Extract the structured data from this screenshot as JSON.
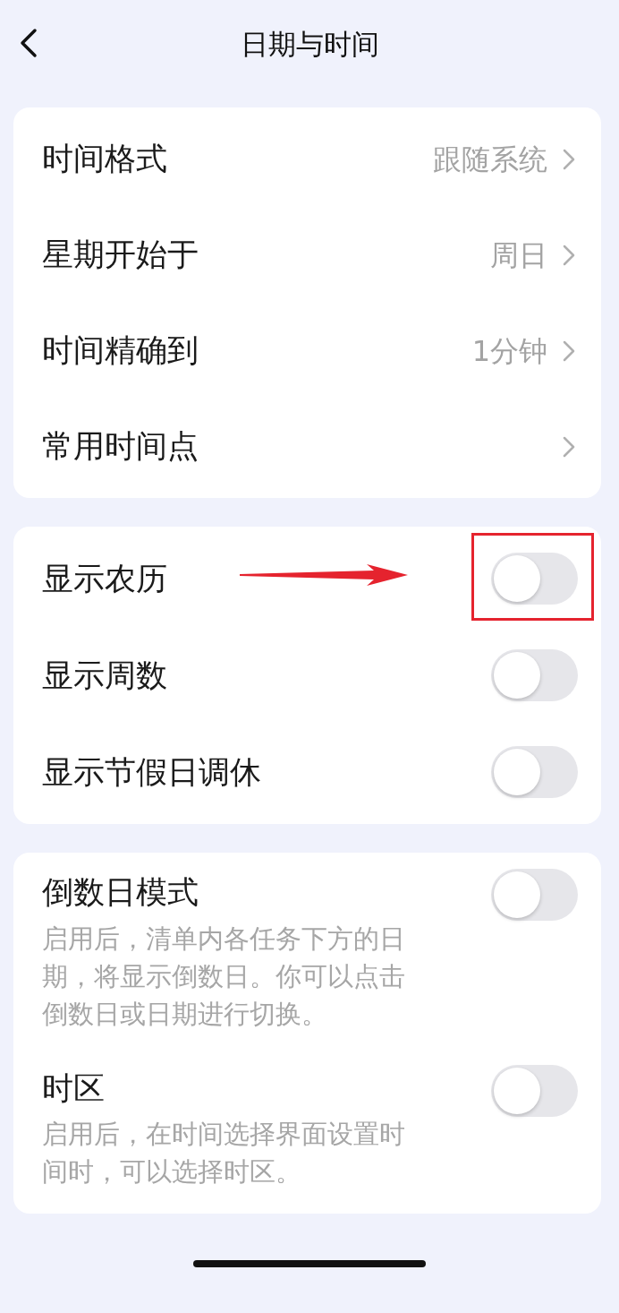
{
  "header": {
    "title": "日期与时间"
  },
  "sections": [
    {
      "items": [
        {
          "kind": "nav",
          "label": "时间格式",
          "value": "跟随系统"
        },
        {
          "kind": "nav",
          "label": "星期开始于",
          "value": "周日"
        },
        {
          "kind": "nav",
          "label": "时间精确到",
          "value": "1分钟"
        },
        {
          "kind": "nav",
          "label": "常用时间点"
        }
      ]
    },
    {
      "items": [
        {
          "kind": "toggle",
          "label": "显示农历",
          "on": false,
          "highlighted": true
        },
        {
          "kind": "toggle",
          "label": "显示周数",
          "on": false,
          "highlighted": false
        },
        {
          "kind": "toggle",
          "label": "显示节假日调休",
          "on": false,
          "highlighted": false
        }
      ]
    },
    {
      "items": [
        {
          "kind": "toggle",
          "label": "倒数日模式",
          "on": false,
          "highlighted": false,
          "description": "启用后，清单内各任务下方的日期，将显示倒数日。你可以点击倒数日或日期进行切换。"
        },
        {
          "kind": "toggle",
          "label": "时区",
          "on": false,
          "highlighted": false,
          "description": "启用后，在时间选择界面设置时间时，可以选择时区。"
        }
      ]
    }
  ]
}
